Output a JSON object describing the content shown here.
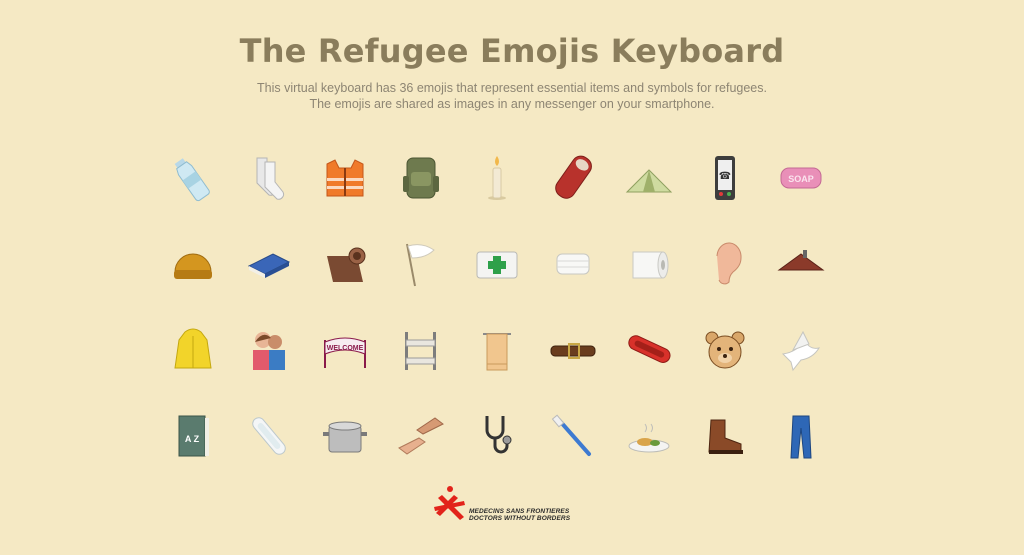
{
  "header": {
    "title": "The Refugee Emojis Keyboard",
    "subtitle_line1": "This virtual keyboard has 36 emojis that represent essential items and symbols for refugees.",
    "subtitle_line2": "The emojis are shared as images in any messenger on your smartphone."
  },
  "emojis": [
    {
      "icon": "water-bottle-icon"
    },
    {
      "icon": "socks-icon"
    },
    {
      "icon": "life-vest-icon"
    },
    {
      "icon": "backpack-icon"
    },
    {
      "icon": "candle-icon"
    },
    {
      "icon": "sleeping-bag-icon"
    },
    {
      "icon": "tent-icon"
    },
    {
      "icon": "mobile-phone-icon"
    },
    {
      "icon": "soap-icon",
      "label": "SOAP"
    },
    {
      "icon": "beanie-hat-icon"
    },
    {
      "icon": "book-icon"
    },
    {
      "icon": "blanket-roll-icon"
    },
    {
      "icon": "white-flag-icon"
    },
    {
      "icon": "first-aid-kit-icon"
    },
    {
      "icon": "face-mask-icon"
    },
    {
      "icon": "toilet-paper-icon"
    },
    {
      "icon": "ear-icon"
    },
    {
      "icon": "roof-icon"
    },
    {
      "icon": "raincoat-icon"
    },
    {
      "icon": "hug-icon"
    },
    {
      "icon": "welcome-banner-icon",
      "label": "WELCOME"
    },
    {
      "icon": "bunk-bed-icon"
    },
    {
      "icon": "towel-icon"
    },
    {
      "icon": "belt-icon"
    },
    {
      "icon": "inflatable-boat-icon"
    },
    {
      "icon": "teddy-bear-icon"
    },
    {
      "icon": "dove-icon"
    },
    {
      "icon": "dictionary-icon",
      "label": "A Z"
    },
    {
      "icon": "sanitary-pad-icon"
    },
    {
      "icon": "cooking-pot-icon"
    },
    {
      "icon": "helping-hands-icon"
    },
    {
      "icon": "stethoscope-icon"
    },
    {
      "icon": "toothbrush-icon"
    },
    {
      "icon": "meal-plate-icon"
    },
    {
      "icon": "hiking-boot-icon"
    },
    {
      "icon": "jeans-icon"
    }
  ],
  "footer": {
    "logo_line1": "MEDECINS SANS FRONTIERES",
    "logo_line2": "DOCTORS WITHOUT BORDERS",
    "logo_icon": "msf-logo-icon",
    "brand_color": "#e2231a"
  }
}
